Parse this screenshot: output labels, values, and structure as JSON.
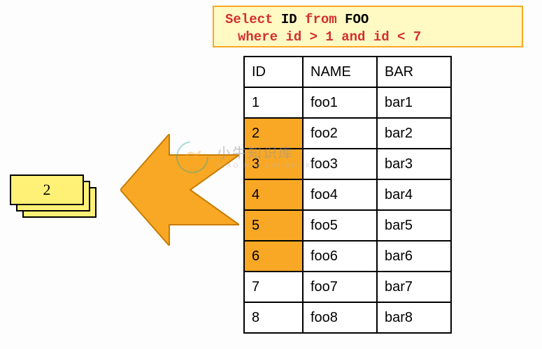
{
  "sql": {
    "select_kw": "Select",
    "id_ident": "ID",
    "from_kw": "from",
    "table_ident": "FOO",
    "where_clause": "where id > 1 and id < 7"
  },
  "table": {
    "headers": {
      "id": "ID",
      "name": "NAME",
      "bar": "BAR"
    },
    "rows": [
      {
        "id": "1",
        "name": "foo1",
        "bar": "bar1",
        "highlight": false
      },
      {
        "id": "2",
        "name": "foo2",
        "bar": "bar2",
        "highlight": true
      },
      {
        "id": "3",
        "name": "foo3",
        "bar": "bar3",
        "highlight": true
      },
      {
        "id": "4",
        "name": "foo4",
        "bar": "bar4",
        "highlight": true
      },
      {
        "id": "5",
        "name": "foo5",
        "bar": "bar5",
        "highlight": true
      },
      {
        "id": "6",
        "name": "foo6",
        "bar": "bar6",
        "highlight": true
      },
      {
        "id": "7",
        "name": "foo7",
        "bar": "bar7",
        "highlight": false
      },
      {
        "id": "8",
        "name": "foo8",
        "bar": "bar8",
        "highlight": false
      }
    ]
  },
  "result": {
    "value": "2"
  },
  "colors": {
    "highlight": "#f9a825",
    "sql_bg": "#fff9c4",
    "keyword": "#d32f2f",
    "card": "#fff176"
  },
  "watermark": {
    "title": "小牛知识库",
    "subtitle": "XIAO NIU ZHI SHI KU"
  }
}
